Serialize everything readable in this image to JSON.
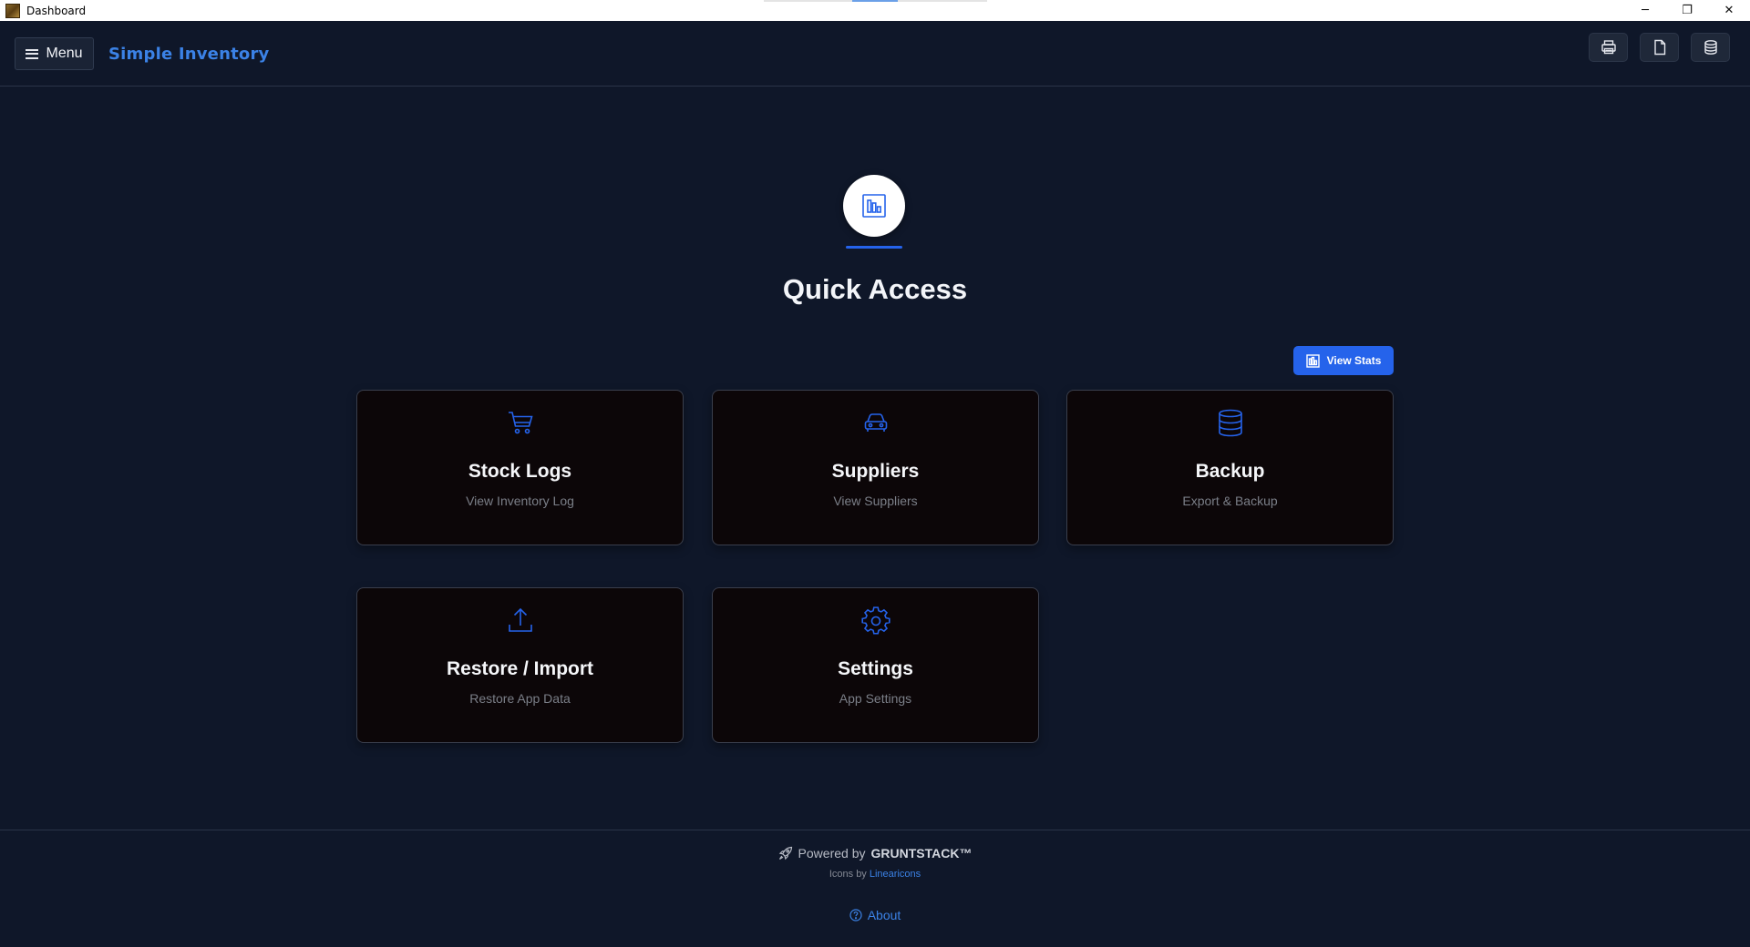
{
  "window": {
    "title": "Dashboard",
    "controls": {
      "minimize": "─",
      "restore": "❐",
      "close": "✕"
    }
  },
  "header": {
    "menu_label": "Menu",
    "brand": "Simple Inventory",
    "icon_buttons": [
      "printer-icon",
      "document-icon",
      "database-icon"
    ]
  },
  "hero": {
    "icon": "bar-chart-icon",
    "title": "Quick Access"
  },
  "view_stats": {
    "label": "View Stats",
    "icon": "chart-icon"
  },
  "cards": [
    {
      "title": "Stock Logs",
      "subtitle": "View Inventory Log",
      "icon": "cart-icon"
    },
    {
      "title": "Suppliers",
      "subtitle": "View Suppliers",
      "icon": "car-icon"
    },
    {
      "title": "Backup",
      "subtitle": "Export & Backup",
      "icon": "database-icon"
    },
    {
      "title": "Restore / Import",
      "subtitle": "Restore App Data",
      "icon": "upload-icon"
    },
    {
      "title": "Settings",
      "subtitle": "App Settings",
      "icon": "cog-icon"
    }
  ],
  "footer": {
    "powered_prefix": "Powered by",
    "powered_brand": "GRUNTSTACK™",
    "icons_prefix": "Icons by",
    "icons_link": "Linearicons",
    "about": "About"
  },
  "colors": {
    "background": "#0f1729",
    "card_background": "#0c0608",
    "accent": "#2563eb",
    "brand": "#3b82e6"
  }
}
